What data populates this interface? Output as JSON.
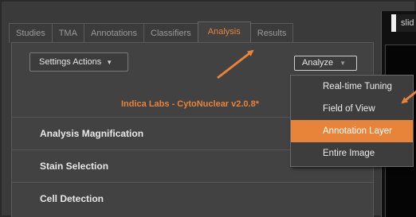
{
  "tabs": [
    {
      "label": "Studies",
      "active": false
    },
    {
      "label": "TMA",
      "active": false
    },
    {
      "label": "Annotations",
      "active": false
    },
    {
      "label": "Classifiers",
      "active": false
    },
    {
      "label": "Analysis",
      "active": true
    },
    {
      "label": "Results",
      "active": false
    }
  ],
  "toolbar": {
    "settings_label": "Settings Actions",
    "analyze_label": "Analyze"
  },
  "algorithm_title": "Indica Labs - CytoNuclear v2.0.8*",
  "sections": [
    {
      "label": "Analysis Magnification"
    },
    {
      "label": "Stain Selection"
    },
    {
      "label": "Cell Detection"
    }
  ],
  "analyze_menu": {
    "items": [
      {
        "label": "Real-time Tuning",
        "highlighted": false
      },
      {
        "label": "Field of View",
        "highlighted": false
      },
      {
        "label": "Annotation Layer",
        "highlighted": true
      },
      {
        "label": "Entire Image",
        "highlighted": false
      }
    ]
  },
  "viewer": {
    "slide_label": "slid"
  },
  "colors": {
    "accent": "#e8833a",
    "panel": "#424242",
    "background": "#1a1a1a"
  }
}
